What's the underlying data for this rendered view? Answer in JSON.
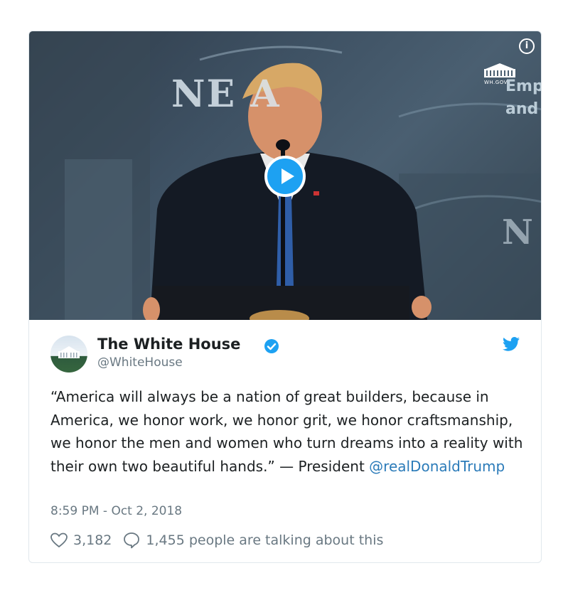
{
  "tweet": {
    "display_name": "The White House",
    "handle": "@WhiteHouse",
    "text_before_mention": "“America will always be a nation of great builders, because in America, we honor work, we honor grit, we honor craftsmanship, we honor the men and women who turn dreams into a reality with their own two beautiful hands.” — President ",
    "mention": "@realDonaldTrump",
    "timestamp": "8:59 PM - Oct 2, 2018",
    "like_count": "3,182",
    "reply_text": "1,455 people are talking about this"
  },
  "media": {
    "logo_text": "WH.GOV",
    "backdrop_left": "NE  A",
    "backdrop_right_line1": "Emp",
    "backdrop_right_line2": "and",
    "backdrop_n": "N",
    "info_glyph": "i"
  },
  "icons": {
    "play": "play-icon",
    "info": "info-icon",
    "verified": "verified-badge-icon",
    "twitter": "twitter-bird-icon",
    "like": "heart-icon",
    "reply": "speech-bubble-icon"
  },
  "colors": {
    "accent": "#1da1f2",
    "link": "#2b7bb9",
    "muted": "#697882",
    "border": "#e1e8ed"
  }
}
